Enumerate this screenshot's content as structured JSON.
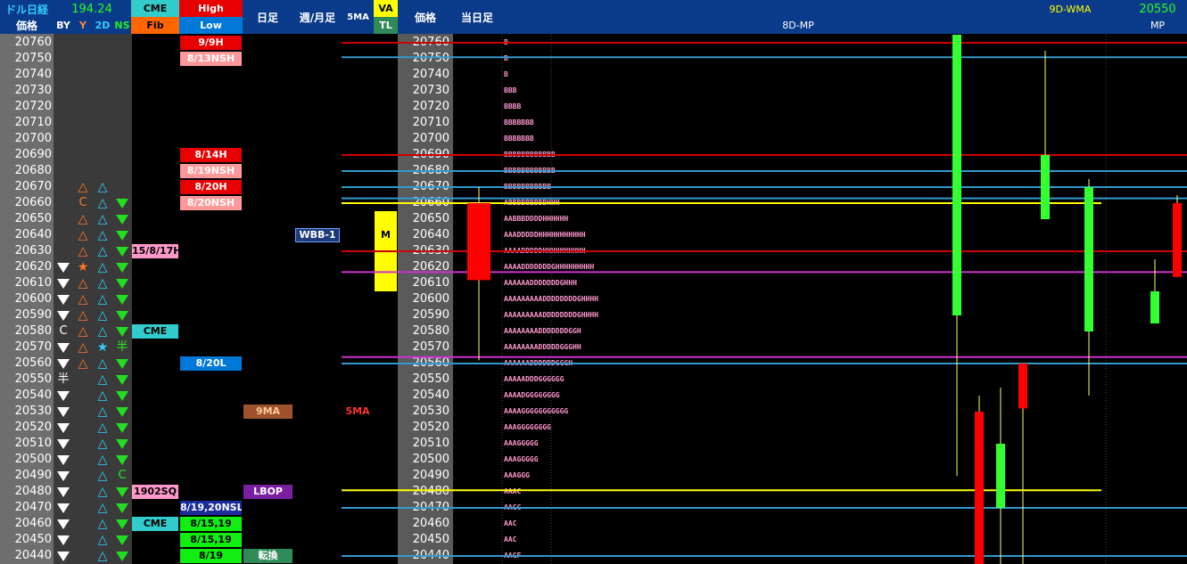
{
  "header": {
    "title_line1": "ドル日経",
    "title_line2": "価格",
    "rate": "194.24",
    "col_by": "BY",
    "col_y": "Y",
    "col_2d": "2D",
    "col_ns": "NS",
    "cme_top": "CME",
    "cme_bottom": "Fib",
    "high": "High",
    "low": "Low",
    "daily": "日足",
    "weekly_monthly": "週/月足",
    "ma5": "5MA",
    "va": "VA",
    "tl": "TL",
    "price2": "価格",
    "today": "当日足",
    "mp8d": "8D-MP",
    "wma9d": "9D-WMA",
    "mp_value": "20550",
    "mp": "MP"
  },
  "rows": [
    {
      "price": "20760",
      "by": "",
      "y": "",
      "d2": "",
      "ns": "",
      "cme": "",
      "hl": "9/9H",
      "hl_color": "red",
      "daily": "",
      "weekly": "",
      "va": false,
      "tpo": "B"
    },
    {
      "price": "20750",
      "by": "",
      "y": "",
      "d2": "",
      "ns": "",
      "cme": "",
      "hl": "8/13NSH",
      "hl_color": "pink",
      "daily": "",
      "weekly": "",
      "va": false,
      "tpo": "B"
    },
    {
      "price": "20740",
      "by": "",
      "y": "",
      "d2": "",
      "ns": "",
      "cme": "",
      "hl": "",
      "hl_color": "",
      "daily": "",
      "weekly": "",
      "va": false,
      "tpo": "B"
    },
    {
      "price": "20730",
      "by": "",
      "y": "",
      "d2": "",
      "ns": "",
      "cme": "",
      "hl": "",
      "hl_color": "",
      "daily": "",
      "weekly": "",
      "va": false,
      "tpo": "BBB"
    },
    {
      "price": "20720",
      "by": "",
      "y": "",
      "d2": "",
      "ns": "",
      "cme": "",
      "hl": "",
      "hl_color": "",
      "daily": "",
      "weekly": "",
      "va": false,
      "tpo": "BBBB"
    },
    {
      "price": "20710",
      "by": "",
      "y": "",
      "d2": "",
      "ns": "",
      "cme": "",
      "hl": "",
      "hl_color": "",
      "daily": "",
      "weekly": "",
      "va": false,
      "tpo": "BBBBBBB"
    },
    {
      "price": "20700",
      "by": "",
      "y": "",
      "d2": "",
      "ns": "",
      "cme": "",
      "hl": "",
      "hl_color": "",
      "daily": "",
      "weekly": "",
      "va": false,
      "tpo": "BBBBBBB"
    },
    {
      "price": "20690",
      "by": "",
      "y": "",
      "d2": "",
      "ns": "",
      "cme": "",
      "hl": "8/14H",
      "hl_color": "red",
      "daily": "",
      "weekly": "",
      "va": false,
      "tpo": "BBBBBBBBBBBB"
    },
    {
      "price": "20680",
      "by": "",
      "y": "",
      "d2": "",
      "ns": "",
      "cme": "",
      "hl": "8/19NSH",
      "hl_color": "pink",
      "daily": "",
      "weekly": "",
      "va": false,
      "tpo": "BBBBBBBBBBBB"
    },
    {
      "price": "20670",
      "by": "",
      "y": "tri-o",
      "d2": "tri-c",
      "ns": "",
      "cme": "",
      "hl": "8/20H",
      "hl_color": "red",
      "daily": "",
      "weekly": "",
      "va": false,
      "tpo": "BBBBBBBBBBB"
    },
    {
      "price": "20660",
      "by": "",
      "y": "C",
      "d2": "tri-c",
      "ns": "down-g",
      "cme": "",
      "hl": "8/20NSH",
      "hl_color": "pink",
      "daily": "",
      "weekly": "",
      "va": false,
      "tpo": "ABBBBBBBBBHHH"
    },
    {
      "price": "20650",
      "by": "",
      "y": "tri-o",
      "d2": "tri-c",
      "ns": "down-g",
      "cme": "",
      "hl": "",
      "hl_color": "",
      "daily": "",
      "weekly": "",
      "va": true,
      "tpo": "AABBBDDDDHHHHHH"
    },
    {
      "price": "20640",
      "by": "",
      "y": "tri-o",
      "d2": "tri-c",
      "ns": "down-g",
      "cme": "",
      "hl": "",
      "hl_color": "",
      "daily": "",
      "weekly": "WBB-1",
      "va": true,
      "va_label": "M",
      "tpo": "AAADDDDDHHHHHHHHHHH"
    },
    {
      "price": "20630",
      "by": "",
      "y": "tri-o",
      "d2": "tri-c",
      "ns": "down-g",
      "cme": "15/8/17H",
      "hl": "",
      "hl_color": "",
      "daily": "",
      "weekly": "",
      "va": true,
      "tpo": "AAAADDDDDHHHHHHHHHH"
    },
    {
      "price": "20620",
      "by": "down",
      "y": "star-o",
      "d2": "tri-c",
      "ns": "down-g",
      "cme": "",
      "hl": "",
      "hl_color": "",
      "daily": "",
      "weekly": "",
      "va": true,
      "tpo": "AAAADDDDDDDGHHHHHHHHH"
    },
    {
      "price": "20610",
      "by": "down",
      "y": "tri-o",
      "d2": "tri-c",
      "ns": "down-g",
      "cme": "",
      "hl": "",
      "hl_color": "",
      "daily": "",
      "weekly": "",
      "va": true,
      "tpo": "AAAAAADDDDDDDGHHH"
    },
    {
      "price": "20600",
      "by": "down",
      "y": "tri-o",
      "d2": "tri-c",
      "ns": "down-g",
      "cme": "",
      "hl": "",
      "hl_color": "",
      "daily": "",
      "weekly": "",
      "va": false,
      "tpo": "AAAAAAAAADDDDDDDDGHHHH"
    },
    {
      "price": "20590",
      "by": "down",
      "y": "tri-o",
      "d2": "tri-c",
      "ns": "down-g",
      "cme": "",
      "hl": "",
      "hl_color": "",
      "daily": "",
      "weekly": "",
      "va": false,
      "tpo": "AAAAAAAAADDDDDDDDGHHHH"
    },
    {
      "price": "20580",
      "by": "C",
      "y": "tri-o",
      "d2": "tri-c",
      "ns": "down-g",
      "cme": "CME",
      "hl": "",
      "hl_color": "",
      "daily": "",
      "weekly": "",
      "va": false,
      "tpo": "AAAAAAAADDDDDDDGGH"
    },
    {
      "price": "20570",
      "by": "down",
      "y": "tri-o",
      "d2": "star-c",
      "ns": "半",
      "cme": "",
      "hl": "",
      "hl_color": "",
      "daily": "",
      "weekly": "",
      "va": false,
      "tpo": "AAAAAAAADDDDDGGGHH"
    },
    {
      "price": "20560",
      "by": "down",
      "y": "tri-o",
      "d2": "tri-c",
      "ns": "down-g",
      "cme": "",
      "hl": "8/20L",
      "hl_color": "blue",
      "daily": "",
      "weekly": "",
      "va": false,
      "tpo": "AAAAAADDDDDDGGGH"
    },
    {
      "price": "20550",
      "by": "半",
      "y": "",
      "d2": "tri-c",
      "ns": "down-g",
      "cme": "",
      "hl": "",
      "hl_color": "",
      "daily": "",
      "weekly": "",
      "va": false,
      "tpo": "AAAAADDDGGGGGG"
    },
    {
      "price": "20540",
      "by": "down",
      "y": "",
      "d2": "tri-c",
      "ns": "down-g",
      "cme": "",
      "hl": "",
      "hl_color": "",
      "daily": "",
      "weekly": "",
      "va": false,
      "tpo": "AAAADGGGGGGGG"
    },
    {
      "price": "20530",
      "by": "down",
      "y": "",
      "d2": "tri-c",
      "ns": "down-g",
      "cme": "",
      "hl": "",
      "hl_color": "",
      "daily": "9MA",
      "weekly": "",
      "ma5": "5MA",
      "va": false,
      "tpo": "AAAAGGGGGGGGGGG"
    },
    {
      "price": "20520",
      "by": "down",
      "y": "",
      "d2": "tri-c",
      "ns": "down-g",
      "cme": "",
      "hl": "",
      "hl_color": "",
      "daily": "",
      "weekly": "",
      "va": false,
      "tpo": "AAAGGGGGGGG"
    },
    {
      "price": "20510",
      "by": "down",
      "y": "",
      "d2": "tri-c",
      "ns": "down-g",
      "cme": "",
      "hl": "",
      "hl_color": "",
      "daily": "",
      "weekly": "",
      "va": false,
      "tpo": "AAAGGGGG"
    },
    {
      "price": "20500",
      "by": "down",
      "y": "",
      "d2": "tri-c",
      "ns": "down-g",
      "cme": "",
      "hl": "",
      "hl_color": "",
      "daily": "",
      "weekly": "",
      "va": false,
      "tpo": "AAAGGGGG"
    },
    {
      "price": "20490",
      "by": "down",
      "y": "",
      "d2": "tri-c",
      "ns": "C",
      "cme": "",
      "hl": "",
      "hl_color": "",
      "daily": "",
      "weekly": "",
      "va": false,
      "tpo": "AAAGGG"
    },
    {
      "price": "20480",
      "by": "down",
      "y": "",
      "d2": "tri-c",
      "ns": "down-g",
      "cme": "1902SQ",
      "hl": "",
      "hl_color": "",
      "daily": "LBOP",
      "weekly": "",
      "va": false,
      "tpo": "AAAC"
    },
    {
      "price": "20470",
      "by": "down",
      "y": "",
      "d2": "tri-c",
      "ns": "down-g",
      "cme": "",
      "hl": "8/19,20NSL",
      "hl_color": "navy",
      "daily": "",
      "weekly": "",
      "va": false,
      "tpo": "AACC"
    },
    {
      "price": "20460",
      "by": "down",
      "y": "",
      "d2": "tri-c",
      "ns": "down-g",
      "cme": "CME",
      "hl": "8/15,19",
      "hl_color": "green",
      "daily": "",
      "weekly": "",
      "va": false,
      "tpo": "AAC"
    },
    {
      "price": "20450",
      "by": "down",
      "y": "",
      "d2": "tri-c",
      "ns": "down-g",
      "cme": "",
      "hl": "8/15,19",
      "hl_color": "green",
      "daily": "",
      "weekly": "",
      "va": false,
      "tpo": "AAC"
    },
    {
      "price": "20440",
      "by": "down",
      "y": "",
      "d2": "tri-c",
      "ns": "down-g",
      "cme": "",
      "hl": "8/19",
      "hl_color": "green",
      "daily": "転換",
      "weekly": "",
      "va": false,
      "tpo": "AACF"
    }
  ],
  "colors": {
    "red": "#e60000",
    "pink": "#ff9999",
    "blue": "#0078d7",
    "navy": "#1a2d9a",
    "green": "#11ee11",
    "cme_cyan": "#33cccc",
    "cme_pink": "#ff99cc",
    "ma9": "#a0522d",
    "lbop": "#7b1fa2",
    "tenkan": "#2e8b57",
    "va_yellow": "#ffff00",
    "wbb": "#1e3a7a",
    "candle_green": "#33ff33",
    "candle_red": "#ff0000",
    "wick": "#ffff66",
    "line_red": "#cc0000",
    "line_blue": "#3399cc",
    "line_yellow": "#ffff00",
    "line_magenta": "#cc33cc"
  },
  "chart_data": {
    "type": "candlestick",
    "title": "8D-MP",
    "ylim": [
      20435,
      20765
    ],
    "today_candle": {
      "open": 20660,
      "close": 20612,
      "high": 20670,
      "low": 20562,
      "color": "red"
    },
    "candles": [
      {
        "open": 20590,
        "close": 20765,
        "high": 20765,
        "low": 20490,
        "color": "green"
      },
      {
        "open": 20530,
        "close": 20435,
        "high": 20540,
        "low": 20435,
        "color": "red"
      },
      {
        "open": 20470,
        "close": 20510,
        "high": 20545,
        "low": 20435,
        "color": "green"
      },
      {
        "open": 20560,
        "close": 20532,
        "high": 20560,
        "low": 20435,
        "color": "red"
      },
      {
        "open": 20650,
        "close": 20690,
        "high": 20755,
        "low": 20650,
        "color": "green"
      },
      {
        "open": 20580,
        "close": 20670,
        "high": 20675,
        "low": 20540,
        "color": "green"
      },
      {
        "open": 20585,
        "close": 20605,
        "high": 20625,
        "low": 20585,
        "color": "green"
      },
      {
        "open": 20660,
        "close": 20614,
        "high": 20665,
        "low": 20614,
        "color": "red"
      }
    ],
    "levels": [
      {
        "price": 20760,
        "color": "red"
      },
      {
        "price": 20751,
        "color": "blue"
      },
      {
        "price": 20690,
        "color": "red"
      },
      {
        "price": 20680,
        "color": "blue"
      },
      {
        "price": 20670,
        "color": "blue"
      },
      {
        "price": 20663,
        "color": "blue"
      },
      {
        "price": 20660,
        "color": "yellow"
      },
      {
        "price": 20630,
        "color": "red"
      },
      {
        "price": 20617,
        "color": "magenta"
      },
      {
        "price": 20564,
        "color": "magenta"
      },
      {
        "price": 20560,
        "color": "blue"
      },
      {
        "price": 20481,
        "color": "yellow"
      },
      {
        "price": 20470,
        "color": "blue"
      },
      {
        "price": 20440,
        "color": "blue"
      }
    ]
  }
}
